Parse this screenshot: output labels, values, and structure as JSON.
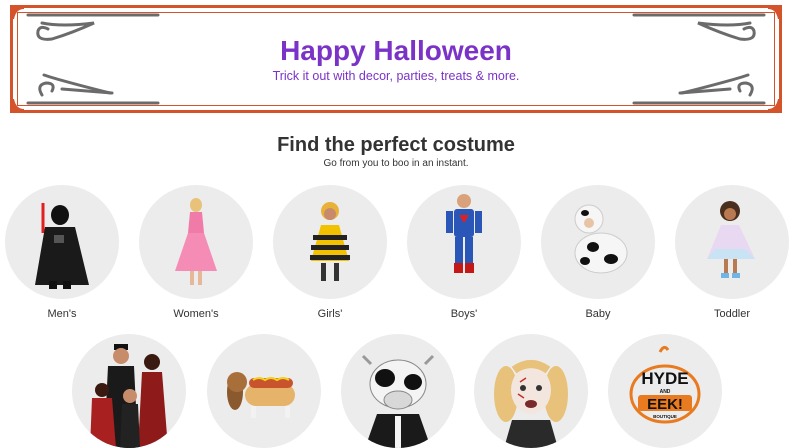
{
  "banner": {
    "title": "Happy Halloween",
    "subtitle": "Trick it out with decor, parties, treats & more."
  },
  "section": {
    "title": "Find the perfect costume",
    "subtitle": "Go from you to boo in an instant."
  },
  "categories": [
    {
      "label": "Men's",
      "icon": "costume-vader"
    },
    {
      "label": "Women's",
      "icon": "costume-princess"
    },
    {
      "label": "Girls'",
      "icon": "costume-bee-girl"
    },
    {
      "label": "Boys'",
      "icon": "costume-superhero"
    },
    {
      "label": "Baby",
      "icon": "costume-cow-baby"
    },
    {
      "label": "Toddler",
      "icon": "costume-unicorn-toddler"
    }
  ],
  "second_row": [
    {
      "icon": "family-vampires"
    },
    {
      "icon": "dog-hotdog"
    },
    {
      "icon": "cow-mask"
    },
    {
      "icon": "girl-face-paint"
    },
    {
      "icon": "hyde-and-eek-logo",
      "logo_text": "HYDE AND EEK! BOUTIQUE"
    }
  ],
  "colors": {
    "accent_purple": "#7b33c7",
    "frame_orange": "#d4532b",
    "circle_bg": "#ececec",
    "swirl_gray": "#6b6b6b"
  }
}
